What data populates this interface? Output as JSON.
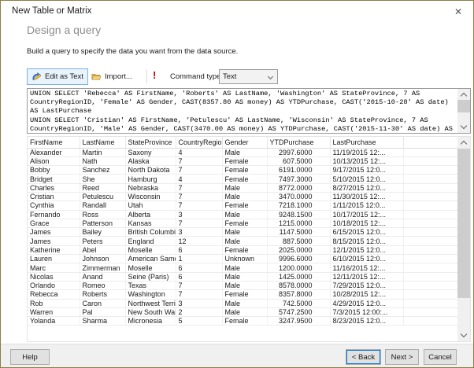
{
  "window": {
    "title": "New Table or Matrix",
    "close_glyph": "✕"
  },
  "header": {
    "heading": "Design a query",
    "description": "Build a query to specify the data you want from the data source."
  },
  "toolbar": {
    "edit_as_text_label": "Edit as Text",
    "import_label": "Import...",
    "run_glyph": "!",
    "command_type_label": "Command type:",
    "command_type_value": "Text"
  },
  "query": {
    "lines": [
      "UNION SELECT 'Rebecca' AS FirstName, 'Roberts' AS LastName, 'Washington' AS StateProvince, 7 AS",
      "CountryRegionID, 'Female' AS Gender, CAST(8357.80 AS money) AS YTDPurchase, CAST('2015-10-28' AS date)",
      "AS LastPurchase",
      "UNION SELECT 'Cristian' AS FirstName, 'Petulescu' AS LastName, 'Wisconsin' AS StateProvince, 7 AS",
      "CountryRegionID, 'Male' AS Gender, CAST(3470.00 AS money) AS YTDPurchase, CAST('2015-11-30' AS date) AS"
    ]
  },
  "grid": {
    "columns": [
      "FirstName",
      "LastName",
      "StateProvince",
      "CountryRegionID",
      "Gender",
      "YTDPurchase",
      "LastPurchase"
    ],
    "rows": [
      [
        "Alexander",
        "Martin",
        "Saxony",
        "4",
        "Male",
        "2997.6000",
        "11/19/2015 12:..."
      ],
      [
        "Alison",
        "Nath",
        "Alaska",
        "7",
        "Female",
        "607.5000",
        "10/13/2015 12:..."
      ],
      [
        "Bobby",
        "Sanchez",
        "North Dakota",
        "7",
        "Female",
        "6191.0000",
        "9/17/2015 12:0..."
      ],
      [
        "Bridget",
        "She",
        "Hamburg",
        "4",
        "Female",
        "7497.3000",
        "5/10/2015 12:0..."
      ],
      [
        "Charles",
        "Reed",
        "Nebraska",
        "7",
        "Male",
        "8772.0000",
        "8/27/2015 12:0..."
      ],
      [
        "Cristian",
        "Petulescu",
        "Wisconsin",
        "7",
        "Male",
        "3470.0000",
        "11/30/2015 12:..."
      ],
      [
        "Cynthia",
        "Randall",
        "Utah",
        "7",
        "Female",
        "7218.1000",
        "1/11/2015 12:0..."
      ],
      [
        "Fernando",
        "Ross",
        "Alberta",
        "3",
        "Male",
        "9248.1500",
        "10/17/2015 12:..."
      ],
      [
        "Grace",
        "Patterson",
        "Kansas",
        "7",
        "Female",
        "1215.0000",
        "10/18/2015 12:..."
      ],
      [
        "James",
        "Bailey",
        "British Columbia",
        "3",
        "Male",
        "1147.5000",
        "6/15/2015 12:0..."
      ],
      [
        "James",
        "Peters",
        "England",
        "12",
        "Male",
        "887.5000",
        "8/15/2015 12:0..."
      ],
      [
        "Katherine",
        "Abel",
        "Moselle",
        "6",
        "Female",
        "2025.0000",
        "12/1/2015 12:0..."
      ],
      [
        "Lauren",
        "Johnson",
        "American Samoa",
        "1",
        "Unknown",
        "9996.6000",
        "6/10/2015 12:0..."
      ],
      [
        "Marc",
        "Zimmerman",
        "Moselle",
        "6",
        "Male",
        "1200.0000",
        "11/16/2015 12:..."
      ],
      [
        "Nicolas",
        "Anand",
        "Seine (Paris)",
        "6",
        "Male",
        "1425.0000",
        "12/11/2015 12:..."
      ],
      [
        "Orlando",
        "Romeo",
        "Texas",
        "7",
        "Male",
        "8578.0000",
        "7/29/2015 12:0..."
      ],
      [
        "Rebecca",
        "Roberts",
        "Washington",
        "7",
        "Female",
        "8357.8000",
        "10/28/2015 12:..."
      ],
      [
        "Rob",
        "Caron",
        "Northwest Terri...",
        "3",
        "Male",
        "742.5000",
        "4/29/2015 12:0..."
      ],
      [
        "Warren",
        "Pal",
        "New South Wales",
        "2",
        "Male",
        "5747.2500",
        "7/3/2015 12:00:..."
      ],
      [
        "Yolanda",
        "Sharma",
        "Micronesia",
        "5",
        "Female",
        "3247.9500",
        "8/23/2015 12:0..."
      ]
    ]
  },
  "footer": {
    "help_label": "Help",
    "back_label": "< Back",
    "next_label": "Next >",
    "cancel_label": "Cancel"
  },
  "colors": {
    "accent": "#0078d7",
    "excl": "#c00000",
    "frame": "#8f7d45"
  }
}
